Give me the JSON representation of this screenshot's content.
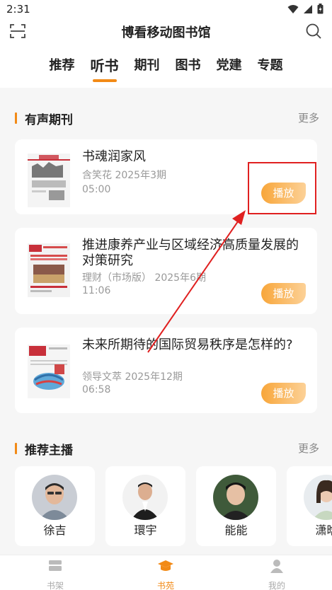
{
  "status_bar": {
    "time": "2:31"
  },
  "header": {
    "title": "博看移动图书馆"
  },
  "tabs": [
    {
      "label": "推荐",
      "active": false
    },
    {
      "label": "听书",
      "active": true
    },
    {
      "label": "期刊",
      "active": false
    },
    {
      "label": "图书",
      "active": false
    },
    {
      "label": "党建",
      "active": false
    },
    {
      "label": "专题",
      "active": false
    }
  ],
  "audio_periodicals": {
    "title": "有声期刊",
    "more": "更多",
    "items": [
      {
        "title": "书魂润家风",
        "source": "含笑花 2025年3期",
        "duration": "05:00",
        "play": "播放"
      },
      {
        "title": "推进康养产业与区域经济高质量发展的对策研究",
        "source": "理财（市场版） 2025年6期",
        "duration": "11:06",
        "play": "播放"
      },
      {
        "title": "未来所期待的国际贸易秩序是怎样的?",
        "source": "领导文萃 2025年12期",
        "duration": "06:58",
        "play": "播放"
      }
    ]
  },
  "hosts_section": {
    "title": "推荐主播",
    "more": "更多",
    "hosts": [
      {
        "name": "徐吉"
      },
      {
        "name": "環宇"
      },
      {
        "name": "能能"
      },
      {
        "name": "潇晗"
      }
    ]
  },
  "bottom_nav": [
    {
      "label": "书架",
      "icon": "bookshelf-icon",
      "active": false
    },
    {
      "label": "书苑",
      "icon": "graduation-cap-icon",
      "active": true
    },
    {
      "label": "我的",
      "icon": "user-icon",
      "active": false
    }
  ],
  "colors": {
    "accent": "#f28a16",
    "annotation": "#e02020"
  }
}
